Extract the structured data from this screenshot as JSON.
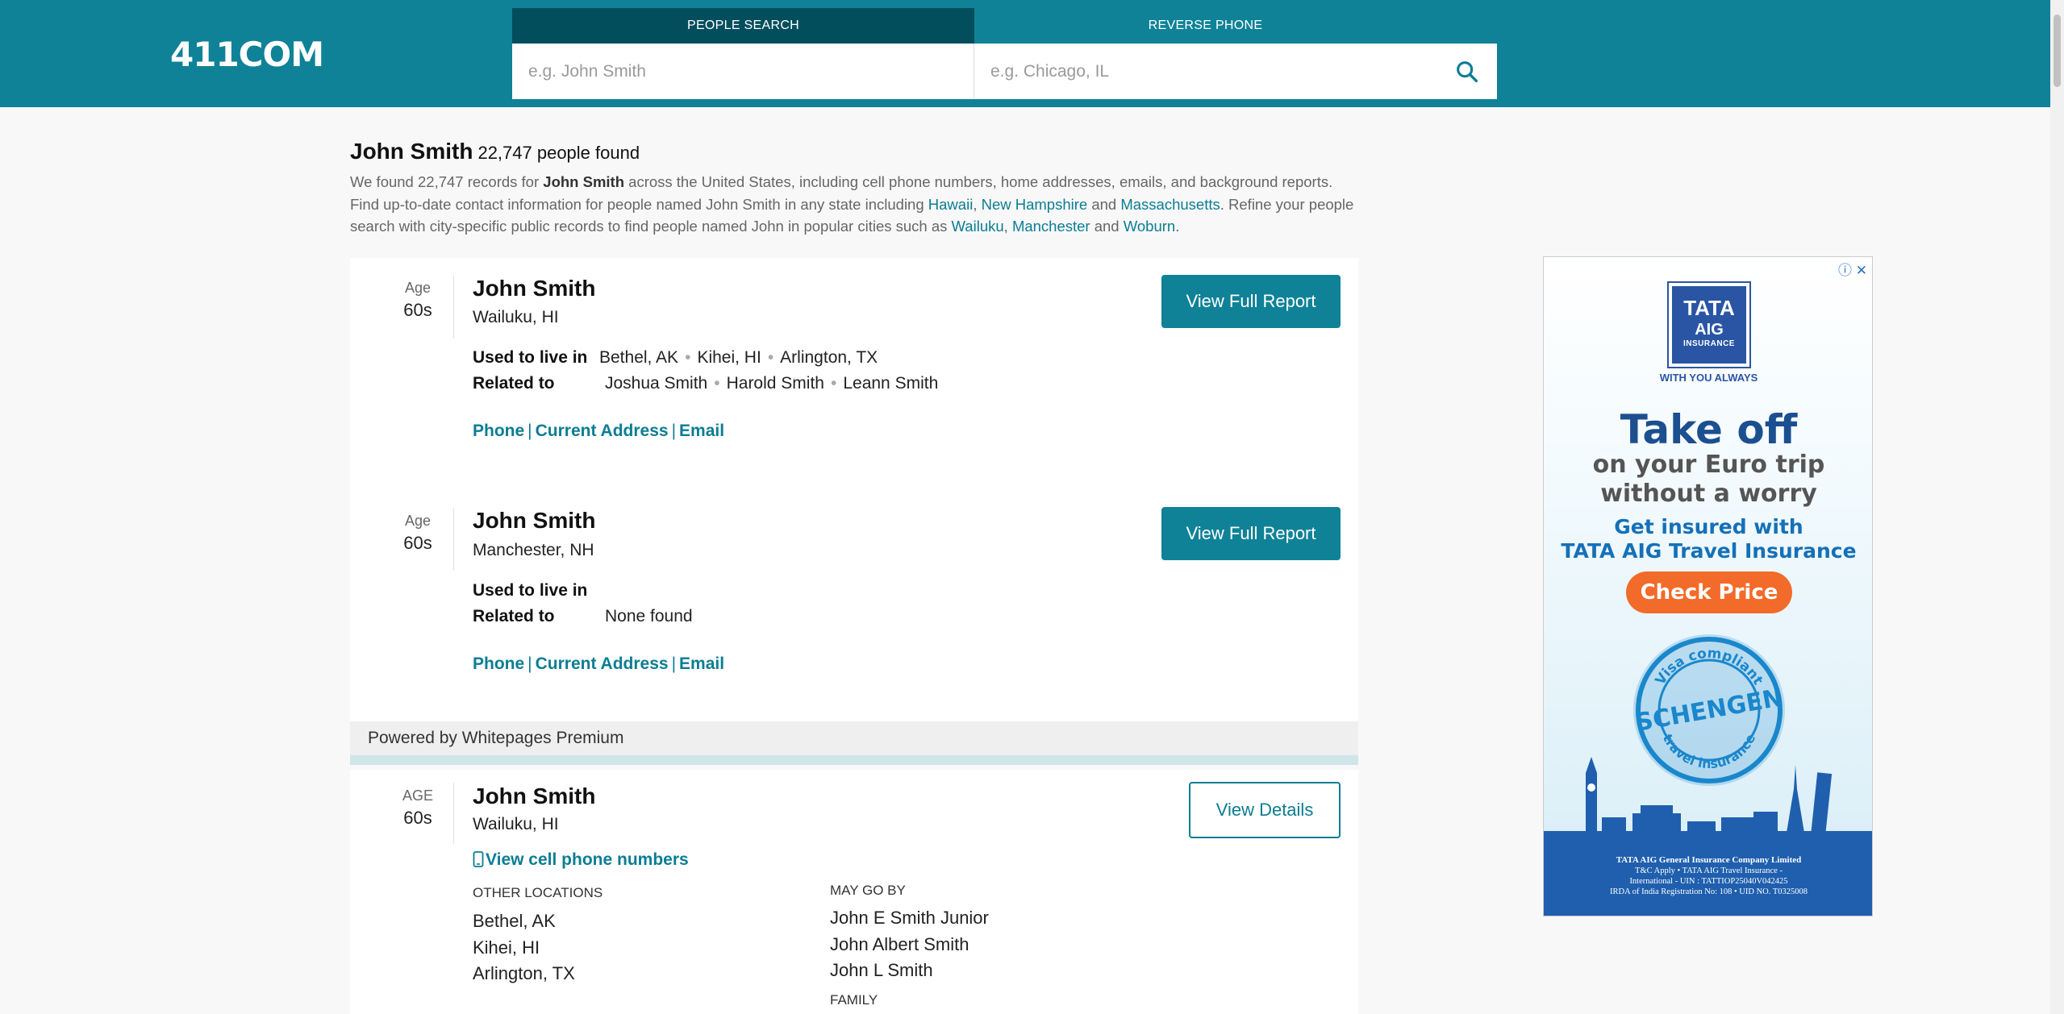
{
  "header": {
    "logo": "411COM",
    "tabs": [
      {
        "label": "PEOPLE SEARCH",
        "active": true
      },
      {
        "label": "REVERSE PHONE",
        "active": false
      }
    ],
    "name_placeholder": "e.g. John Smith",
    "location_placeholder": "e.g. Chicago, IL",
    "search_icon": "search-icon"
  },
  "intro": {
    "query": "John Smith",
    "count_text": "22,747 people found",
    "p1_a": "We found 22,747 records for ",
    "p1_name": "John Smith",
    "p1_b": " across the United States, including cell phone numbers, home addresses, emails, and background reports.",
    "p2_a": "Find up-to-date contact information for people named John Smith in any state including ",
    "states": [
      "Hawaii",
      "New Hampshire",
      "Massachusetts"
    ],
    "comma": ", ",
    "and": " and ",
    "p2_b": ". Refine your people search with city-specific public records to find people named John in popular cities such as ",
    "cities": [
      "Wailuku",
      "Manchester",
      "Woburn"
    ],
    "period": "."
  },
  "results": [
    {
      "age_label": "Age",
      "age": "60s",
      "name": "John Smith",
      "location": "Wailuku, HI",
      "used_label": "Used to live in",
      "used": [
        "Bethel, AK",
        "Kihei, HI",
        "Arlington, TX"
      ],
      "related_label": "Related to",
      "related": [
        "Joshua Smith",
        "Harold Smith",
        "Leann Smith"
      ],
      "links": [
        "Phone",
        "Current Address",
        "Email"
      ],
      "button": "View Full Report"
    },
    {
      "age_label": "Age",
      "age": "60s",
      "name": "John Smith",
      "location": "Manchester, NH",
      "used_label": "Used to live in",
      "related_label": "Related to",
      "related_text": "None found",
      "links": [
        "Phone",
        "Current Address",
        "Email"
      ],
      "button": "View Full Report"
    }
  ],
  "link_sep": "|",
  "dot": "•",
  "powered_by": "Powered by Whitepages Premium",
  "premium": {
    "age_label": "AGE",
    "age": "60s",
    "name": "John Smith",
    "location": "Wailuku, HI",
    "phone_link": "View cell phone numbers",
    "button": "View Details",
    "other_locations_label": "OTHER LOCATIONS",
    "other_locations": [
      "Bethel, AK",
      "Kihei, HI",
      "Arlington, TX"
    ],
    "may_go_by_label": "MAY GO BY",
    "may_go_by": [
      "John E Smith Junior",
      "John Albert Smith",
      "John L Smith"
    ],
    "family_label": "FAMILY"
  },
  "ad": {
    "logo_line1": "TATA",
    "logo_line2": "AIG",
    "logo_line3": "INSURANCE",
    "tagline": "WITH YOU ALWAYS",
    "headline": "Take off",
    "sub1": "on your Euro trip",
    "sub2": "without a worry",
    "sub3": "Get insured with",
    "sub4": "TATA AIG Travel Insurance",
    "cta": "Check Price",
    "stamp_top": "Visa compliant",
    "stamp_mid": "SCHENGEN",
    "stamp_bottom": "travel insurance",
    "foot1": "TATA AIG General Insurance Company Limited",
    "foot2": "T&C Apply  •  TATA AIG Travel Insurance -",
    "foot3": "International - UIN : TATTIOP25040V042425",
    "foot4": "IRDA of India Registration No: 108  •  UID NO. T0325008",
    "info_icon": "ⓘ",
    "close_icon": "✕"
  }
}
